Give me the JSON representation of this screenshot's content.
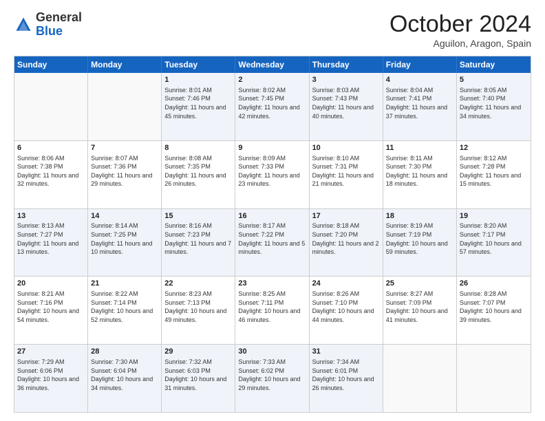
{
  "header": {
    "logo": {
      "line1": "General",
      "line2": "Blue"
    },
    "title": "October 2024",
    "location": "Aguilon, Aragon, Spain"
  },
  "weekdays": [
    "Sunday",
    "Monday",
    "Tuesday",
    "Wednesday",
    "Thursday",
    "Friday",
    "Saturday"
  ],
  "rows": [
    [
      {
        "day": "",
        "sunrise": "",
        "sunset": "",
        "daylight": "",
        "empty": true
      },
      {
        "day": "",
        "sunrise": "",
        "sunset": "",
        "daylight": "",
        "empty": true
      },
      {
        "day": "1",
        "sunrise": "Sunrise: 8:01 AM",
        "sunset": "Sunset: 7:46 PM",
        "daylight": "Daylight: 11 hours and 45 minutes.",
        "empty": false
      },
      {
        "day": "2",
        "sunrise": "Sunrise: 8:02 AM",
        "sunset": "Sunset: 7:45 PM",
        "daylight": "Daylight: 11 hours and 42 minutes.",
        "empty": false
      },
      {
        "day": "3",
        "sunrise": "Sunrise: 8:03 AM",
        "sunset": "Sunset: 7:43 PM",
        "daylight": "Daylight: 11 hours and 40 minutes.",
        "empty": false
      },
      {
        "day": "4",
        "sunrise": "Sunrise: 8:04 AM",
        "sunset": "Sunset: 7:41 PM",
        "daylight": "Daylight: 11 hours and 37 minutes.",
        "empty": false
      },
      {
        "day": "5",
        "sunrise": "Sunrise: 8:05 AM",
        "sunset": "Sunset: 7:40 PM",
        "daylight": "Daylight: 11 hours and 34 minutes.",
        "empty": false
      }
    ],
    [
      {
        "day": "6",
        "sunrise": "Sunrise: 8:06 AM",
        "sunset": "Sunset: 7:38 PM",
        "daylight": "Daylight: 11 hours and 32 minutes.",
        "empty": false
      },
      {
        "day": "7",
        "sunrise": "Sunrise: 8:07 AM",
        "sunset": "Sunset: 7:36 PM",
        "daylight": "Daylight: 11 hours and 29 minutes.",
        "empty": false
      },
      {
        "day": "8",
        "sunrise": "Sunrise: 8:08 AM",
        "sunset": "Sunset: 7:35 PM",
        "daylight": "Daylight: 11 hours and 26 minutes.",
        "empty": false
      },
      {
        "day": "9",
        "sunrise": "Sunrise: 8:09 AM",
        "sunset": "Sunset: 7:33 PM",
        "daylight": "Daylight: 11 hours and 23 minutes.",
        "empty": false
      },
      {
        "day": "10",
        "sunrise": "Sunrise: 8:10 AM",
        "sunset": "Sunset: 7:31 PM",
        "daylight": "Daylight: 11 hours and 21 minutes.",
        "empty": false
      },
      {
        "day": "11",
        "sunrise": "Sunrise: 8:11 AM",
        "sunset": "Sunset: 7:30 PM",
        "daylight": "Daylight: 11 hours and 18 minutes.",
        "empty": false
      },
      {
        "day": "12",
        "sunrise": "Sunrise: 8:12 AM",
        "sunset": "Sunset: 7:28 PM",
        "daylight": "Daylight: 11 hours and 15 minutes.",
        "empty": false
      }
    ],
    [
      {
        "day": "13",
        "sunrise": "Sunrise: 8:13 AM",
        "sunset": "Sunset: 7:27 PM",
        "daylight": "Daylight: 11 hours and 13 minutes.",
        "empty": false
      },
      {
        "day": "14",
        "sunrise": "Sunrise: 8:14 AM",
        "sunset": "Sunset: 7:25 PM",
        "daylight": "Daylight: 11 hours and 10 minutes.",
        "empty": false
      },
      {
        "day": "15",
        "sunrise": "Sunrise: 8:16 AM",
        "sunset": "Sunset: 7:23 PM",
        "daylight": "Daylight: 11 hours and 7 minutes.",
        "empty": false
      },
      {
        "day": "16",
        "sunrise": "Sunrise: 8:17 AM",
        "sunset": "Sunset: 7:22 PM",
        "daylight": "Daylight: 11 hours and 5 minutes.",
        "empty": false
      },
      {
        "day": "17",
        "sunrise": "Sunrise: 8:18 AM",
        "sunset": "Sunset: 7:20 PM",
        "daylight": "Daylight: 11 hours and 2 minutes.",
        "empty": false
      },
      {
        "day": "18",
        "sunrise": "Sunrise: 8:19 AM",
        "sunset": "Sunset: 7:19 PM",
        "daylight": "Daylight: 10 hours and 59 minutes.",
        "empty": false
      },
      {
        "day": "19",
        "sunrise": "Sunrise: 8:20 AM",
        "sunset": "Sunset: 7:17 PM",
        "daylight": "Daylight: 10 hours and 57 minutes.",
        "empty": false
      }
    ],
    [
      {
        "day": "20",
        "sunrise": "Sunrise: 8:21 AM",
        "sunset": "Sunset: 7:16 PM",
        "daylight": "Daylight: 10 hours and 54 minutes.",
        "empty": false
      },
      {
        "day": "21",
        "sunrise": "Sunrise: 8:22 AM",
        "sunset": "Sunset: 7:14 PM",
        "daylight": "Daylight: 10 hours and 52 minutes.",
        "empty": false
      },
      {
        "day": "22",
        "sunrise": "Sunrise: 8:23 AM",
        "sunset": "Sunset: 7:13 PM",
        "daylight": "Daylight: 10 hours and 49 minutes.",
        "empty": false
      },
      {
        "day": "23",
        "sunrise": "Sunrise: 8:25 AM",
        "sunset": "Sunset: 7:11 PM",
        "daylight": "Daylight: 10 hours and 46 minutes.",
        "empty": false
      },
      {
        "day": "24",
        "sunrise": "Sunrise: 8:26 AM",
        "sunset": "Sunset: 7:10 PM",
        "daylight": "Daylight: 10 hours and 44 minutes.",
        "empty": false
      },
      {
        "day": "25",
        "sunrise": "Sunrise: 8:27 AM",
        "sunset": "Sunset: 7:09 PM",
        "daylight": "Daylight: 10 hours and 41 minutes.",
        "empty": false
      },
      {
        "day": "26",
        "sunrise": "Sunrise: 8:28 AM",
        "sunset": "Sunset: 7:07 PM",
        "daylight": "Daylight: 10 hours and 39 minutes.",
        "empty": false
      }
    ],
    [
      {
        "day": "27",
        "sunrise": "Sunrise: 7:29 AM",
        "sunset": "Sunset: 6:06 PM",
        "daylight": "Daylight: 10 hours and 36 minutes.",
        "empty": false
      },
      {
        "day": "28",
        "sunrise": "Sunrise: 7:30 AM",
        "sunset": "Sunset: 6:04 PM",
        "daylight": "Daylight: 10 hours and 34 minutes.",
        "empty": false
      },
      {
        "day": "29",
        "sunrise": "Sunrise: 7:32 AM",
        "sunset": "Sunset: 6:03 PM",
        "daylight": "Daylight: 10 hours and 31 minutes.",
        "empty": false
      },
      {
        "day": "30",
        "sunrise": "Sunrise: 7:33 AM",
        "sunset": "Sunset: 6:02 PM",
        "daylight": "Daylight: 10 hours and 29 minutes.",
        "empty": false
      },
      {
        "day": "31",
        "sunrise": "Sunrise: 7:34 AM",
        "sunset": "Sunset: 6:01 PM",
        "daylight": "Daylight: 10 hours and 26 minutes.",
        "empty": false
      },
      {
        "day": "",
        "sunrise": "",
        "sunset": "",
        "daylight": "",
        "empty": true
      },
      {
        "day": "",
        "sunrise": "",
        "sunset": "",
        "daylight": "",
        "empty": true
      }
    ]
  ],
  "alt_rows": [
    0,
    2,
    4
  ]
}
